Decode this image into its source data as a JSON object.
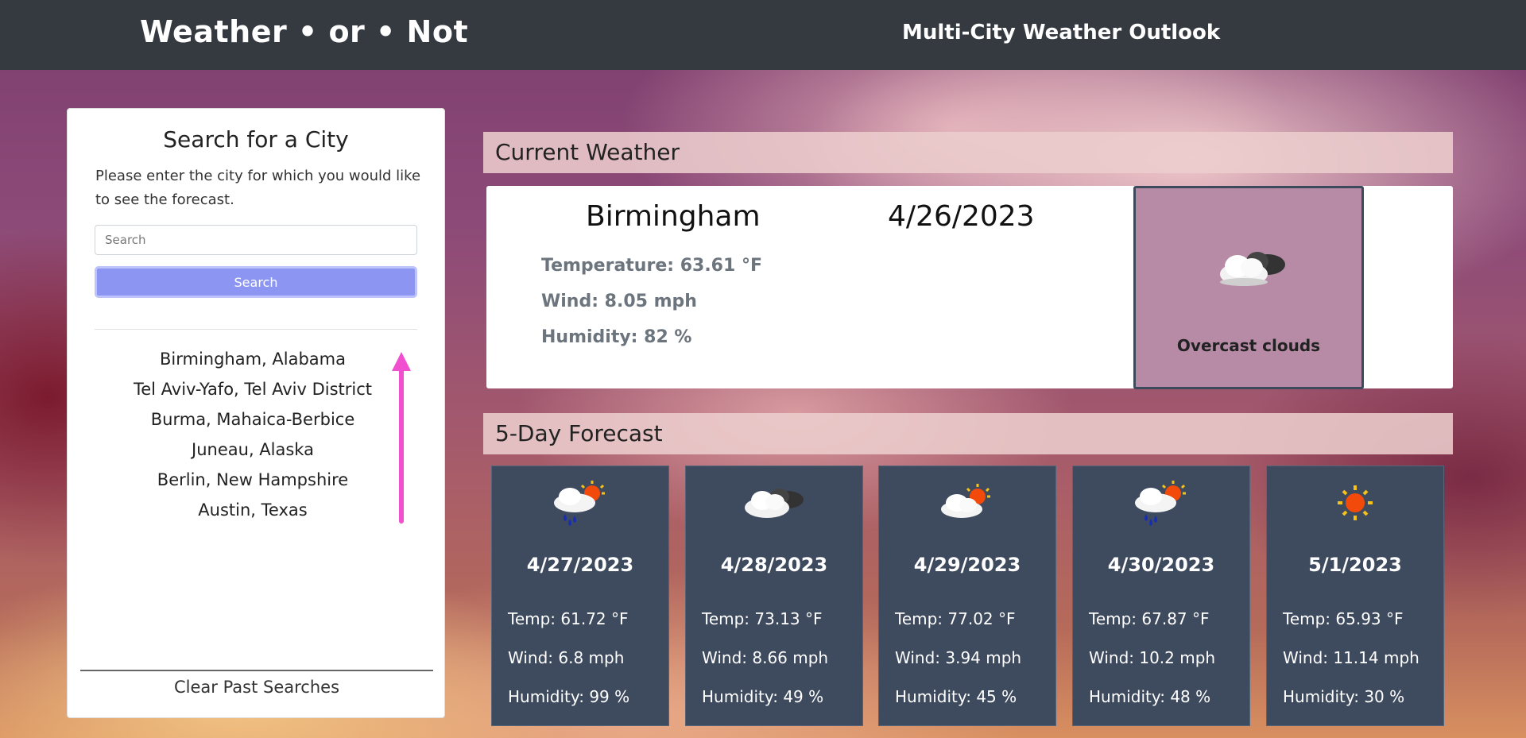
{
  "header": {
    "brand": "Weather • or • Not",
    "subtitle": "Multi-City Weather Outlook"
  },
  "sidebar": {
    "title": "Search for a City",
    "description": "Please enter the city for which you would like to see the forecast.",
    "search_placeholder": "Search",
    "search_value": "",
    "search_button": "Search",
    "history": [
      "Birmingham, Alabama",
      "Tel Aviv-Yafo, Tel Aviv District",
      "Burma, Mahaica-Berbice",
      "Juneau, Alaska",
      "Berlin, New Hampshire",
      "Austin, Texas"
    ],
    "clear_button": "Clear Past Searches"
  },
  "current": {
    "section_title": "Current Weather",
    "city": "Birmingham",
    "date": "4/26/2023",
    "temperature": "Temperature: 63.61 °F",
    "wind": "Wind: 8.05 mph",
    "humidity": "Humidity: 82 %",
    "condition": "Overcast clouds",
    "icon": "overcast-clouds-icon"
  },
  "forecast": {
    "section_title": "5-Day Forecast",
    "days": [
      {
        "date": "4/27/2023",
        "temp": "Temp: 61.72 °F",
        "wind": "Wind: 6.8 mph",
        "humidity": "Humidity: 99 %",
        "icon": "rain-sun-icon"
      },
      {
        "date": "4/28/2023",
        "temp": "Temp: 73.13 °F",
        "wind": "Wind: 8.66 mph",
        "humidity": "Humidity: 49 %",
        "icon": "overcast-clouds-icon"
      },
      {
        "date": "4/29/2023",
        "temp": "Temp: 77.02 °F",
        "wind": "Wind: 3.94 mph",
        "humidity": "Humidity: 45 %",
        "icon": "partly-cloudy-icon"
      },
      {
        "date": "4/30/2023",
        "temp": "Temp: 67.87 °F",
        "wind": "Wind: 10.2 mph",
        "humidity": "Humidity: 48 %",
        "icon": "rain-sun-icon"
      },
      {
        "date": "5/1/2023",
        "temp": "Temp: 65.93 °F",
        "wind": "Wind: 11.14 mph",
        "humidity": "Humidity: 30 %",
        "icon": "clear-sun-icon"
      }
    ]
  },
  "colors": {
    "navbar": "#343a40",
    "search_button": "#8c96f2",
    "condition_box": "#b78ba6",
    "forecast_card": "#3e4a5e",
    "arrow": "#f050d0"
  }
}
